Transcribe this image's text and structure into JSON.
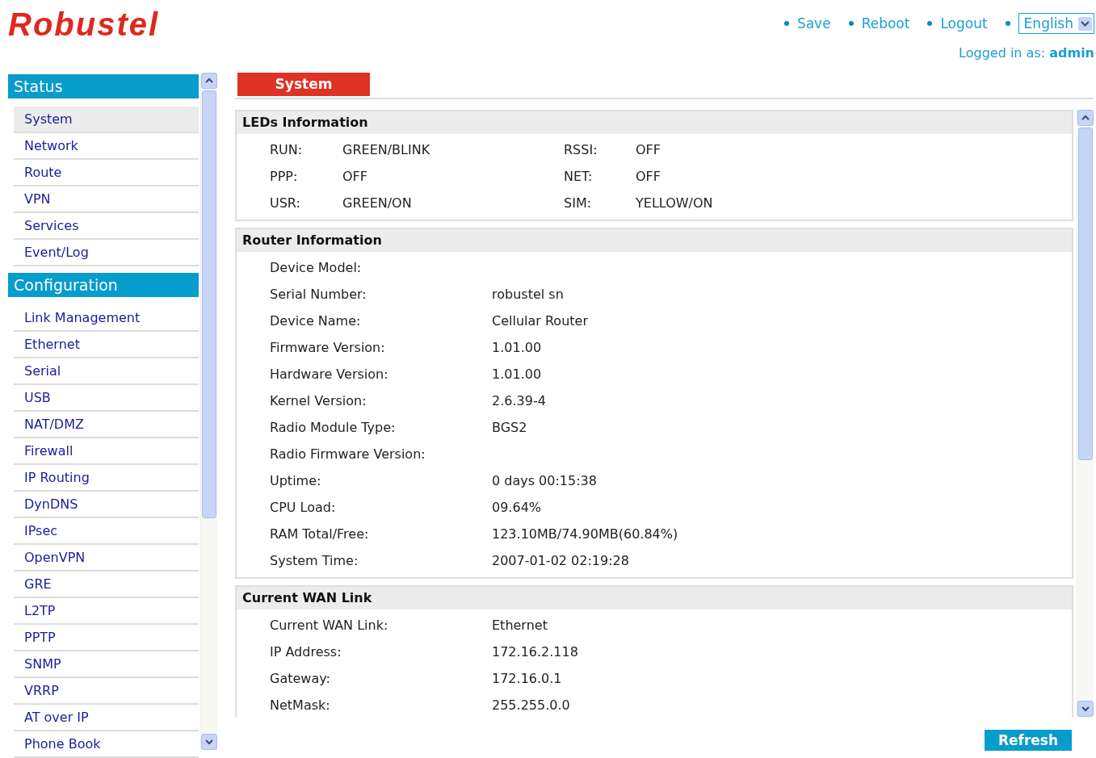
{
  "header": {
    "logo": "Robustel",
    "links": [
      "Save",
      "Reboot",
      "Logout"
    ],
    "language": "English",
    "login_label": "Logged in as:",
    "login_user": "admin"
  },
  "sidebar": {
    "sections": [
      {
        "title": "Status",
        "items": [
          {
            "label": "System",
            "selected": true
          },
          {
            "label": "Network",
            "selected": false
          },
          {
            "label": "Route",
            "selected": false
          },
          {
            "label": "VPN",
            "selected": false
          },
          {
            "label": "Services",
            "selected": false
          },
          {
            "label": "Event/Log",
            "selected": false
          }
        ]
      },
      {
        "title": "Configuration",
        "items": [
          {
            "label": "Link Management",
            "selected": false
          },
          {
            "label": "Ethernet",
            "selected": false
          },
          {
            "label": "Serial",
            "selected": false
          },
          {
            "label": "USB",
            "selected": false
          },
          {
            "label": "NAT/DMZ",
            "selected": false
          },
          {
            "label": "Firewall",
            "selected": false
          },
          {
            "label": "IP Routing",
            "selected": false
          },
          {
            "label": "DynDNS",
            "selected": false
          },
          {
            "label": "IPsec",
            "selected": false
          },
          {
            "label": "OpenVPN",
            "selected": false
          },
          {
            "label": "GRE",
            "selected": false
          },
          {
            "label": "L2TP",
            "selected": false
          },
          {
            "label": "PPTP",
            "selected": false
          },
          {
            "label": "SNMP",
            "selected": false
          },
          {
            "label": "VRRP",
            "selected": false
          },
          {
            "label": "AT over IP",
            "selected": false
          },
          {
            "label": "Phone Book",
            "selected": false
          }
        ]
      }
    ]
  },
  "tabs": [
    {
      "label": "System",
      "selected": true
    }
  ],
  "sections": [
    {
      "kind": "pairs",
      "title": "LEDs Information",
      "rows": [
        {
          "label": "RUN:",
          "value": "GREEN/BLINK"
        },
        {
          "label": "RSSI:",
          "value": "OFF"
        },
        {
          "label": "PPP:",
          "value": "OFF"
        },
        {
          "label": "NET:",
          "value": "OFF"
        },
        {
          "label": "USR:",
          "value": "GREEN/ON"
        },
        {
          "label": "SIM:",
          "value": "YELLOW/ON"
        }
      ]
    },
    {
      "kind": "list",
      "title": "Router Information",
      "rows": [
        {
          "label": "Device Model:"
        },
        {
          "label": "Serial Number:",
          "value": "robustel sn"
        },
        {
          "label": "Device Name:",
          "value": "Cellular Router"
        },
        {
          "label": "Firmware Version:",
          "value": "1.01.00"
        },
        {
          "label": "Hardware Version:",
          "value": "1.01.00"
        },
        {
          "label": "Kernel Version:",
          "value": "2.6.39-4"
        },
        {
          "label": "Radio Module Type:",
          "value": "BGS2"
        },
        {
          "label": "Radio Firmware Version:"
        },
        {
          "label": "Uptime:",
          "value": "0 days 00:15:38"
        },
        {
          "label": "CPU Load:",
          "value": "09.64%"
        },
        {
          "label": "RAM Total/Free:",
          "value": "123.10MB/74.90MB(60.84%)"
        },
        {
          "label": "System Time:",
          "value": "2007-01-02 02:19:28"
        }
      ]
    },
    {
      "kind": "list",
      "title": "Current WAN Link",
      "rows": [
        {
          "label": "Current WAN Link:",
          "value": "Ethernet"
        },
        {
          "label": "IP Address:",
          "value": "172.16.2.118"
        },
        {
          "label": "Gateway:",
          "value": "172.16.0.1"
        },
        {
          "label": "NetMask:",
          "value": "255.255.0.0"
        }
      ]
    }
  ],
  "refresh_button": "Refresh"
}
